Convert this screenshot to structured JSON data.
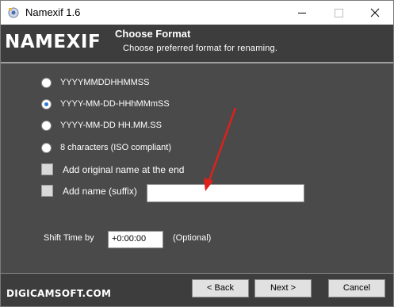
{
  "window": {
    "title": "Namexif 1.6"
  },
  "header": {
    "logo": "NAMEXIF",
    "title": "Choose Format",
    "subtitle": "Choose preferred format for renaming."
  },
  "formats": [
    {
      "label": "YYYYMMDDHHMMSS",
      "checked": false
    },
    {
      "label": "YYYY-MM-DD-HHhMMmSS",
      "checked": true
    },
    {
      "label": "YYYY-MM-DD HH.MM.SS",
      "checked": false
    },
    {
      "label": "8 characters (ISO compliant)",
      "checked": false
    }
  ],
  "options": {
    "add_original_label": "Add original name at the end",
    "add_suffix_label": "Add name (suffix)",
    "suffix_value": ""
  },
  "shift": {
    "label": "Shift Time by",
    "value": "+0:00:00",
    "optional": "(Optional)"
  },
  "footer": {
    "brand": "DIGICAMSOFT.COM",
    "back_label": "< Back",
    "next_label": "Next >",
    "cancel_label": "Cancel"
  },
  "colors": {
    "banner": "#3d3d3d",
    "content": "#4a4a4a",
    "annotation_arrow": "#e0201b",
    "radio_selected": "#2e7bd1"
  }
}
